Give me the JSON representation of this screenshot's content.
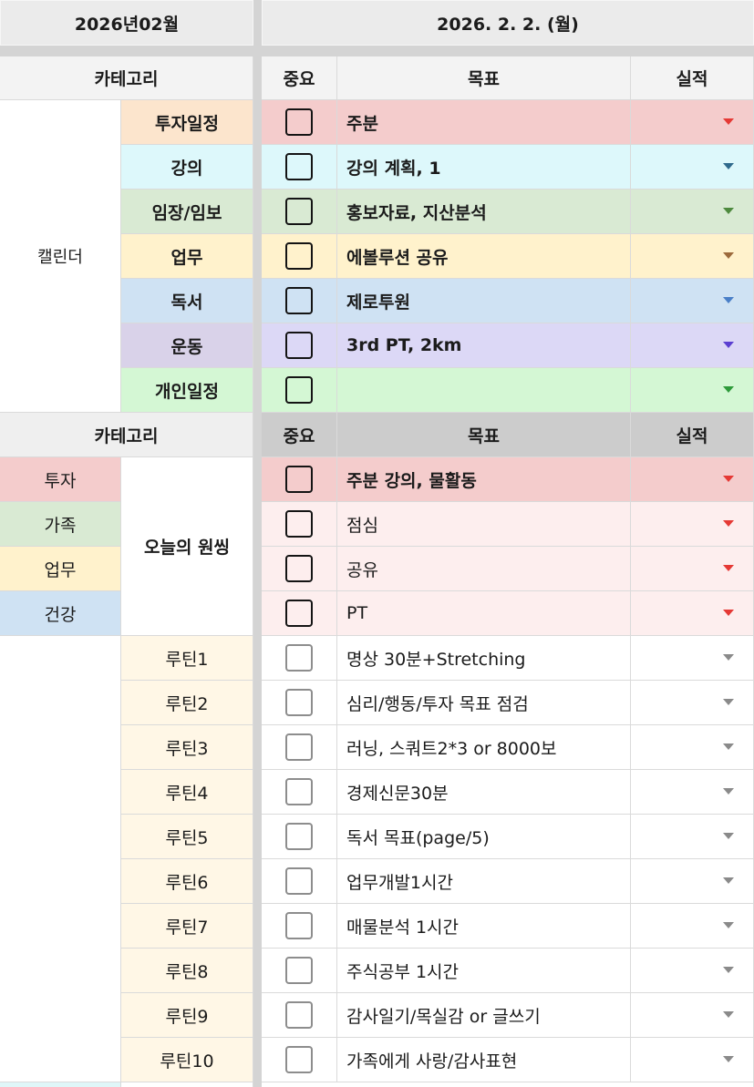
{
  "header": {
    "month": "2026년02월",
    "date": "2026. 2. 2. (월)"
  },
  "calendar": {
    "headers": {
      "category": "카테고리",
      "importance": "중요",
      "goal": "목표",
      "result": "실적"
    },
    "group_label": "캘린더",
    "rows": [
      {
        "category": "투자일정",
        "important": false,
        "goal": "주분",
        "result": "",
        "category_color": "#fce5cd",
        "row_color": "#f4cccc",
        "arrow_color": "#e53935"
      },
      {
        "category": "강의",
        "important": false,
        "goal": "강의 계획, 1",
        "result": "",
        "category_color": "#ddf8fb",
        "row_color": "#ddf8fb",
        "arrow_color": "#2f6a8c"
      },
      {
        "category": "임장/임보",
        "important": false,
        "goal": "홍보자료, 지산분석",
        "result": "",
        "category_color": "#d9ead3",
        "row_color": "#d9ead3",
        "arrow_color": "#4e8a3e"
      },
      {
        "category": "업무",
        "important": false,
        "goal": "에볼루션 공유",
        "result": "",
        "category_color": "#fff2cc",
        "row_color": "#fff2cc",
        "arrow_color": "#9c6a3c"
      },
      {
        "category": "독서",
        "important": false,
        "goal": "제로투원",
        "result": "",
        "category_color": "#cfe2f3",
        "row_color": "#cfe2f3",
        "arrow_color": "#4a7fc7"
      },
      {
        "category": "운동",
        "important": false,
        "goal": "3rd PT, 2km",
        "result": "",
        "category_color": "#d9d2e9",
        "row_color": "#dcd8f6",
        "arrow_color": "#5b3fd1"
      },
      {
        "category": "개인일정",
        "important": false,
        "goal": "",
        "result": "",
        "category_color": "#d4f7d4",
        "row_color": "#d4f7d4",
        "arrow_color": "#2e9a3a"
      }
    ]
  },
  "one_thing": {
    "headers": {
      "category": "카테고리",
      "importance": "중요",
      "goal": "목표",
      "result": "실적"
    },
    "group_label": "오늘의 원씽",
    "rows": [
      {
        "area": "투자",
        "important": false,
        "goal": "주분 강의, 물활동",
        "result": "",
        "area_color": "#f4cccc",
        "row_color": "#f4cccc",
        "arrow_color": "#e53935"
      },
      {
        "area": "가족",
        "important": false,
        "goal": "점심",
        "result": "",
        "area_color": "#d9ead3",
        "row_color": "#fdeeee",
        "arrow_color": "#e53935"
      },
      {
        "area": "업무",
        "important": false,
        "goal": "공유",
        "result": "",
        "area_color": "#fff2cc",
        "row_color": "#fdeeee",
        "arrow_color": "#e53935"
      },
      {
        "area": "건강",
        "important": false,
        "goal": "PT",
        "result": "",
        "area_color": "#cfe2f3",
        "row_color": "#fdeeee",
        "arrow_color": "#e53935"
      }
    ]
  },
  "routines": {
    "label_color": "#fff7e6",
    "arrow_color": "#8a8a8a",
    "rows": [
      {
        "label": "루틴1",
        "important": false,
        "goal": "명상 30분+Stretching",
        "result": ""
      },
      {
        "label": "루틴2",
        "important": false,
        "goal": "심리/행동/투자 목표 점검",
        "result": ""
      },
      {
        "label": "루틴3",
        "important": false,
        "goal": "러닝, 스쿼트2*3 or 8000보",
        "result": ""
      },
      {
        "label": "루틴4",
        "important": false,
        "goal": "경제신문30분",
        "result": ""
      },
      {
        "label": "루틴5",
        "important": false,
        "goal": "독서 목표(page/5)",
        "result": ""
      },
      {
        "label": "루틴6",
        "important": false,
        "goal": "업무개발1시간",
        "result": ""
      },
      {
        "label": "루틴7",
        "important": false,
        "goal": "매물분석 1시간",
        "result": ""
      },
      {
        "label": "루틴8",
        "important": false,
        "goal": "주식공부 1시간",
        "result": ""
      },
      {
        "label": "루틴9",
        "important": false,
        "goal": "감사일기/목실감 or 글쓰기",
        "result": ""
      },
      {
        "label": "루틴10",
        "important": false,
        "goal": "가족에게 사랑/감사표현",
        "result": ""
      }
    ]
  },
  "next_row": {
    "label_color": "#dff6f8"
  }
}
